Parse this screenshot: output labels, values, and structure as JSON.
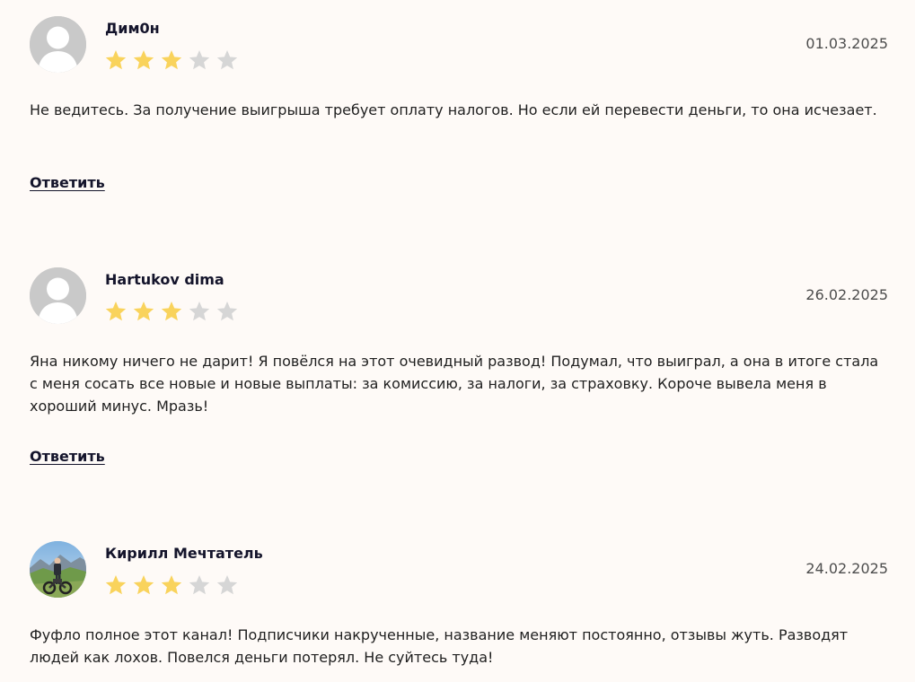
{
  "reviews": [
    {
      "author": "Дим0н",
      "rating": 3,
      "max_rating": 5,
      "date": "01.03.2025",
      "text": "Не ведитесь. За получение выигрыша требует оплату налогов. Но если ей перевести деньги, то она исчезает.",
      "reply_label": "Ответить",
      "avatar": "default-user-icon"
    },
    {
      "author": "Hartukov dima",
      "rating": 3,
      "max_rating": 5,
      "date": "26.02.2025",
      "text": "Яна никому ничего не дарит! Я повёлся на этот очевидный развод! Подумал, что выиграл, а она в итоге стала с меня сосать все новые и новые выплаты: за комиссию, за налоги, за страховку. Короче вывела меня в хороший минус. Мразь!",
      "reply_label": "Ответить",
      "avatar": "default-user-icon"
    },
    {
      "author": "Кирилл Мечтатель",
      "rating": 3,
      "max_rating": 5,
      "date": "24.02.2025",
      "text": "Фуфло полное этот канал! Подписчики накрученные, название меняют постоянно, отзывы жуть. Разводят людей как лохов. Повелся деньги потерял. Не суйтесь туда!",
      "avatar": "photo"
    }
  ],
  "colors": {
    "background": "#fefaf7",
    "star_filled": "#f9d35c",
    "star_empty": "#d6d6d6",
    "avatar_placeholder": "#c9c9c9"
  }
}
